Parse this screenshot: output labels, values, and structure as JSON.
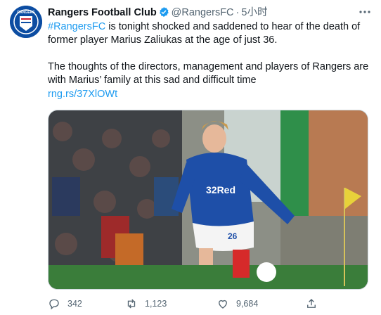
{
  "account": {
    "name": "Rangers Football Club",
    "handle": "@RangersFC",
    "separator": "·",
    "time": "5小时",
    "avatar_icon": "rangers-crest-icon",
    "avatar_text": "RANGERS"
  },
  "tweet": {
    "hashtag": "#RangersFC",
    "line1_rest": " is tonight shocked and saddened to hear of the death of former player Marius Zaliukas at the age of just 36.",
    "paragraph2": "The thoughts of the directors, management and players of Rangers are with Marius’ family at this sad and difficult time",
    "short_url": "rng.rs/37XlOWt"
  },
  "media": {
    "sponsor_text": "32Red",
    "shirt_number": "26"
  },
  "actions": {
    "reply_count": "342",
    "retweet_count": "1,123",
    "like_count": "9,684"
  },
  "colors": {
    "link": "#1d9bf0",
    "verified": "#1d9bf0",
    "rangers_blue": "#0c4da2"
  }
}
